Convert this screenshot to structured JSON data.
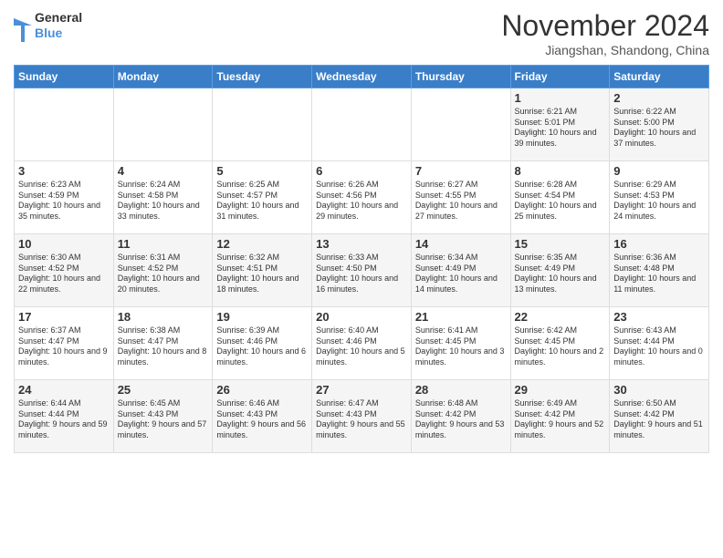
{
  "header": {
    "logo_line1": "General",
    "logo_line2": "Blue",
    "month": "November 2024",
    "location": "Jiangshan, Shandong, China"
  },
  "days_of_week": [
    "Sunday",
    "Monday",
    "Tuesday",
    "Wednesday",
    "Thursday",
    "Friday",
    "Saturday"
  ],
  "weeks": [
    [
      {
        "day": "",
        "info": ""
      },
      {
        "day": "",
        "info": ""
      },
      {
        "day": "",
        "info": ""
      },
      {
        "day": "",
        "info": ""
      },
      {
        "day": "",
        "info": ""
      },
      {
        "day": "1",
        "info": "Sunrise: 6:21 AM\nSunset: 5:01 PM\nDaylight: 10 hours and 39 minutes."
      },
      {
        "day": "2",
        "info": "Sunrise: 6:22 AM\nSunset: 5:00 PM\nDaylight: 10 hours and 37 minutes."
      }
    ],
    [
      {
        "day": "3",
        "info": "Sunrise: 6:23 AM\nSunset: 4:59 PM\nDaylight: 10 hours and 35 minutes."
      },
      {
        "day": "4",
        "info": "Sunrise: 6:24 AM\nSunset: 4:58 PM\nDaylight: 10 hours and 33 minutes."
      },
      {
        "day": "5",
        "info": "Sunrise: 6:25 AM\nSunset: 4:57 PM\nDaylight: 10 hours and 31 minutes."
      },
      {
        "day": "6",
        "info": "Sunrise: 6:26 AM\nSunset: 4:56 PM\nDaylight: 10 hours and 29 minutes."
      },
      {
        "day": "7",
        "info": "Sunrise: 6:27 AM\nSunset: 4:55 PM\nDaylight: 10 hours and 27 minutes."
      },
      {
        "day": "8",
        "info": "Sunrise: 6:28 AM\nSunset: 4:54 PM\nDaylight: 10 hours and 25 minutes."
      },
      {
        "day": "9",
        "info": "Sunrise: 6:29 AM\nSunset: 4:53 PM\nDaylight: 10 hours and 24 minutes."
      }
    ],
    [
      {
        "day": "10",
        "info": "Sunrise: 6:30 AM\nSunset: 4:52 PM\nDaylight: 10 hours and 22 minutes."
      },
      {
        "day": "11",
        "info": "Sunrise: 6:31 AM\nSunset: 4:52 PM\nDaylight: 10 hours and 20 minutes."
      },
      {
        "day": "12",
        "info": "Sunrise: 6:32 AM\nSunset: 4:51 PM\nDaylight: 10 hours and 18 minutes."
      },
      {
        "day": "13",
        "info": "Sunrise: 6:33 AM\nSunset: 4:50 PM\nDaylight: 10 hours and 16 minutes."
      },
      {
        "day": "14",
        "info": "Sunrise: 6:34 AM\nSunset: 4:49 PM\nDaylight: 10 hours and 14 minutes."
      },
      {
        "day": "15",
        "info": "Sunrise: 6:35 AM\nSunset: 4:49 PM\nDaylight: 10 hours and 13 minutes."
      },
      {
        "day": "16",
        "info": "Sunrise: 6:36 AM\nSunset: 4:48 PM\nDaylight: 10 hours and 11 minutes."
      }
    ],
    [
      {
        "day": "17",
        "info": "Sunrise: 6:37 AM\nSunset: 4:47 PM\nDaylight: 10 hours and 9 minutes."
      },
      {
        "day": "18",
        "info": "Sunrise: 6:38 AM\nSunset: 4:47 PM\nDaylight: 10 hours and 8 minutes."
      },
      {
        "day": "19",
        "info": "Sunrise: 6:39 AM\nSunset: 4:46 PM\nDaylight: 10 hours and 6 minutes."
      },
      {
        "day": "20",
        "info": "Sunrise: 6:40 AM\nSunset: 4:46 PM\nDaylight: 10 hours and 5 minutes."
      },
      {
        "day": "21",
        "info": "Sunrise: 6:41 AM\nSunset: 4:45 PM\nDaylight: 10 hours and 3 minutes."
      },
      {
        "day": "22",
        "info": "Sunrise: 6:42 AM\nSunset: 4:45 PM\nDaylight: 10 hours and 2 minutes."
      },
      {
        "day": "23",
        "info": "Sunrise: 6:43 AM\nSunset: 4:44 PM\nDaylight: 10 hours and 0 minutes."
      }
    ],
    [
      {
        "day": "24",
        "info": "Sunrise: 6:44 AM\nSunset: 4:44 PM\nDaylight: 9 hours and 59 minutes."
      },
      {
        "day": "25",
        "info": "Sunrise: 6:45 AM\nSunset: 4:43 PM\nDaylight: 9 hours and 57 minutes."
      },
      {
        "day": "26",
        "info": "Sunrise: 6:46 AM\nSunset: 4:43 PM\nDaylight: 9 hours and 56 minutes."
      },
      {
        "day": "27",
        "info": "Sunrise: 6:47 AM\nSunset: 4:43 PM\nDaylight: 9 hours and 55 minutes."
      },
      {
        "day": "28",
        "info": "Sunrise: 6:48 AM\nSunset: 4:42 PM\nDaylight: 9 hours and 53 minutes."
      },
      {
        "day": "29",
        "info": "Sunrise: 6:49 AM\nSunset: 4:42 PM\nDaylight: 9 hours and 52 minutes."
      },
      {
        "day": "30",
        "info": "Sunrise: 6:50 AM\nSunset: 4:42 PM\nDaylight: 9 hours and 51 minutes."
      }
    ]
  ]
}
